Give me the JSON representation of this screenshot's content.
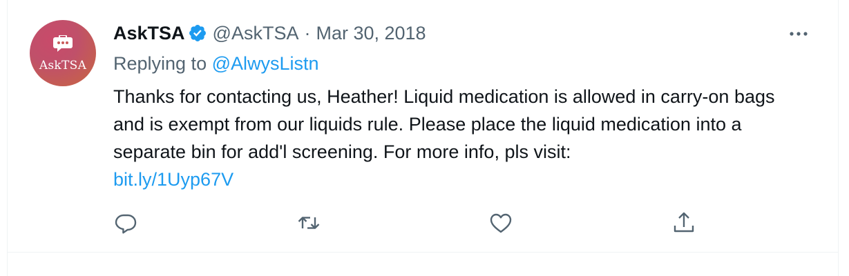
{
  "tweet": {
    "avatar_text": "AskTSA",
    "display_name": "AskTSA",
    "handle": "@AskTSA",
    "separator": "·",
    "date": "Mar 30, 2018",
    "replying_prefix": "Replying to",
    "replying_to": "@AlwysListn",
    "text": "Thanks for contacting us, Heather! Liquid medication is allowed in carry-on bags and is exempt from our liquids rule. Please place the liquid medication into a separate bin for add'l screening. For more info, pls visit:",
    "link": "bit.ly/1Uyp67V"
  },
  "icons": {
    "verified": "verified-badge-icon",
    "more": "more-horizontal-icon",
    "reply": "reply-icon",
    "retweet": "retweet-icon",
    "like": "like-icon",
    "share": "share-icon"
  },
  "colors": {
    "accent": "#1d9bf0",
    "secondary_text": "#536471",
    "primary_text": "#0f1419",
    "border": "#eff3f4"
  }
}
